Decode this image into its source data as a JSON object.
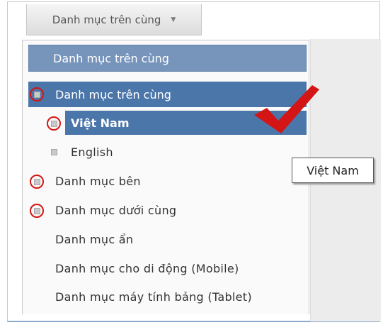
{
  "top_button": {
    "label": "Danh mục trên cùng",
    "caret": "▼"
  },
  "menu": {
    "header": "Danh mục trên cùng",
    "items": [
      {
        "label": "Danh mục trên cùng"
      },
      {
        "label": "Việt Nam"
      },
      {
        "label": "English"
      },
      {
        "label": "Danh mục bên"
      },
      {
        "label": "Danh mục dưới cùng"
      },
      {
        "label": "Danh mục ẩn"
      },
      {
        "label": "Danh mục cho di động (Mobile)"
      },
      {
        "label": "Danh mục máy tính bảng (Tablet)"
      }
    ]
  },
  "tooltip": {
    "text": "Việt Nam"
  },
  "colors": {
    "selected": "#4b76aa",
    "header": "#7794bb",
    "annotation": "#d31515"
  }
}
